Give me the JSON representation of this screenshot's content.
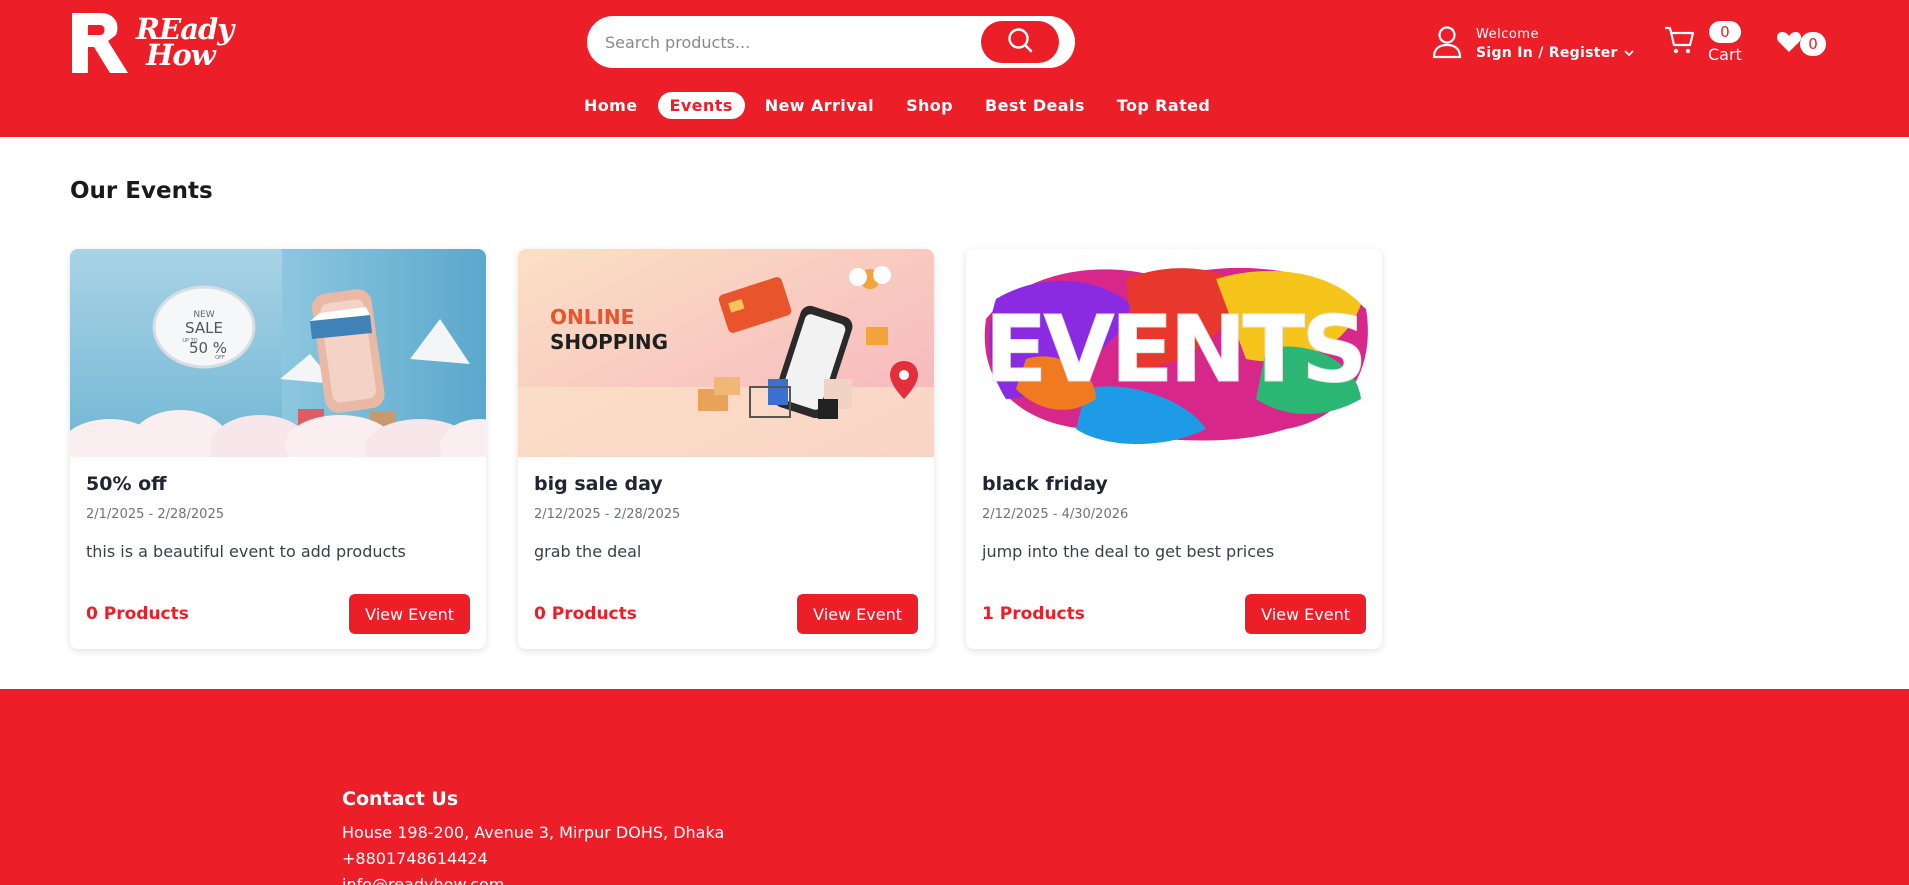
{
  "brand": {
    "logo_text_line1": "REady",
    "logo_text_line2": "How",
    "accent": "#ec1f28"
  },
  "search": {
    "placeholder": "Search products...",
    "value": ""
  },
  "user": {
    "welcome": "Welcome",
    "signin": "Sign In / Register"
  },
  "cart": {
    "count": "0",
    "label": "Cart"
  },
  "wishlist": {
    "count": "0"
  },
  "nav": {
    "items": [
      {
        "label": "Home",
        "active": false
      },
      {
        "label": "Events",
        "active": true
      },
      {
        "label": "New Arrival",
        "active": false
      },
      {
        "label": "Shop",
        "active": false
      },
      {
        "label": "Best Deals",
        "active": false
      },
      {
        "label": "Top Rated",
        "active": false
      }
    ]
  },
  "main": {
    "title": "Our Events",
    "events": [
      {
        "title": "50% off",
        "dates": "2/1/2025 - 2/28/2025",
        "description": "this is a beautiful event to add products",
        "products": "0 Products",
        "button": "View Event",
        "image_text": {
          "line1": "NEW",
          "line2": "SALE",
          "line3": "UP TO",
          "line4": "50 %",
          "line5": "OFF"
        }
      },
      {
        "title": "big sale day",
        "dates": "2/12/2025 - 2/28/2025",
        "description": "grab the deal",
        "products": "0 Products",
        "button": "View Event",
        "image_text": {
          "line1": "ONLINE",
          "line2": "SHOPPING"
        }
      },
      {
        "title": "black friday",
        "dates": "2/12/2025 - 4/30/2026",
        "description": "jump into the deal to get best prices",
        "products": "1 Products",
        "button": "View Event",
        "image_text": {
          "line1": "EVENTS"
        }
      }
    ]
  },
  "footer": {
    "contact_title": "Contact Us",
    "address": "House 198-200, Avenue 3, Mirpur DOHS, Dhaka",
    "phone": "+8801748614424",
    "email": "info@readyhow.com"
  }
}
